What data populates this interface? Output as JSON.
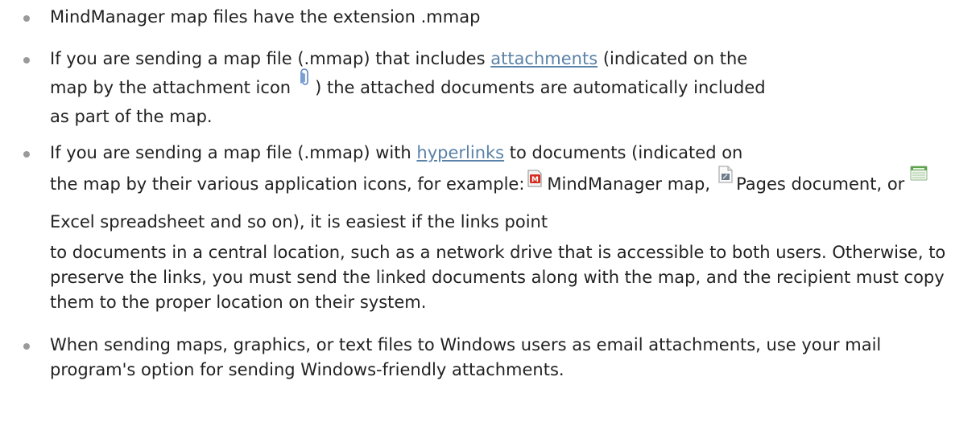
{
  "items": [
    {
      "text": "MindManager map files have the extension .mmap"
    },
    {
      "text_before_link": "If you are sending a map file (.mmap) that includes ",
      "link": "attachments",
      "text_after_link": " (indicated on the",
      "line2_before_icon": "map by the attachment icon",
      "line2_after_icon": ") the attached documents are automatically included",
      "line3": "as part of the map."
    },
    {
      "text_before_link": "If you are sending a map file (.mmap) with ",
      "link": "hyperlinks",
      "text_after_link": " to documents (indicated on",
      "line2_before_icon": "the map by their various application icons, for example:",
      "mindmanager_label": "MindManager map,",
      "pages_label": "Pages  document, or",
      "excel_label": "Excel spreadsheet and so on), it is easiest if the links point",
      "rest": "to documents in a central location, such as a network drive that is accessible to both users. Otherwise, to preserve the links, you must send the linked documents along with the map, and the recipient must copy them to the proper location on their system."
    },
    {
      "text": "When sending maps, graphics, or text files to Windows users as email attachments, use your mail program's option for sending Windows-friendly attachments."
    }
  ],
  "icons": {
    "attachment": "paperclip-icon",
    "mindmanager": "mindmanager-file-icon",
    "pages": "pages-document-icon",
    "excel": "excel-spreadsheet-icon"
  },
  "colors": {
    "text": "#222222",
    "link": "#5b82a8",
    "bullet": "#9a9a9a"
  }
}
